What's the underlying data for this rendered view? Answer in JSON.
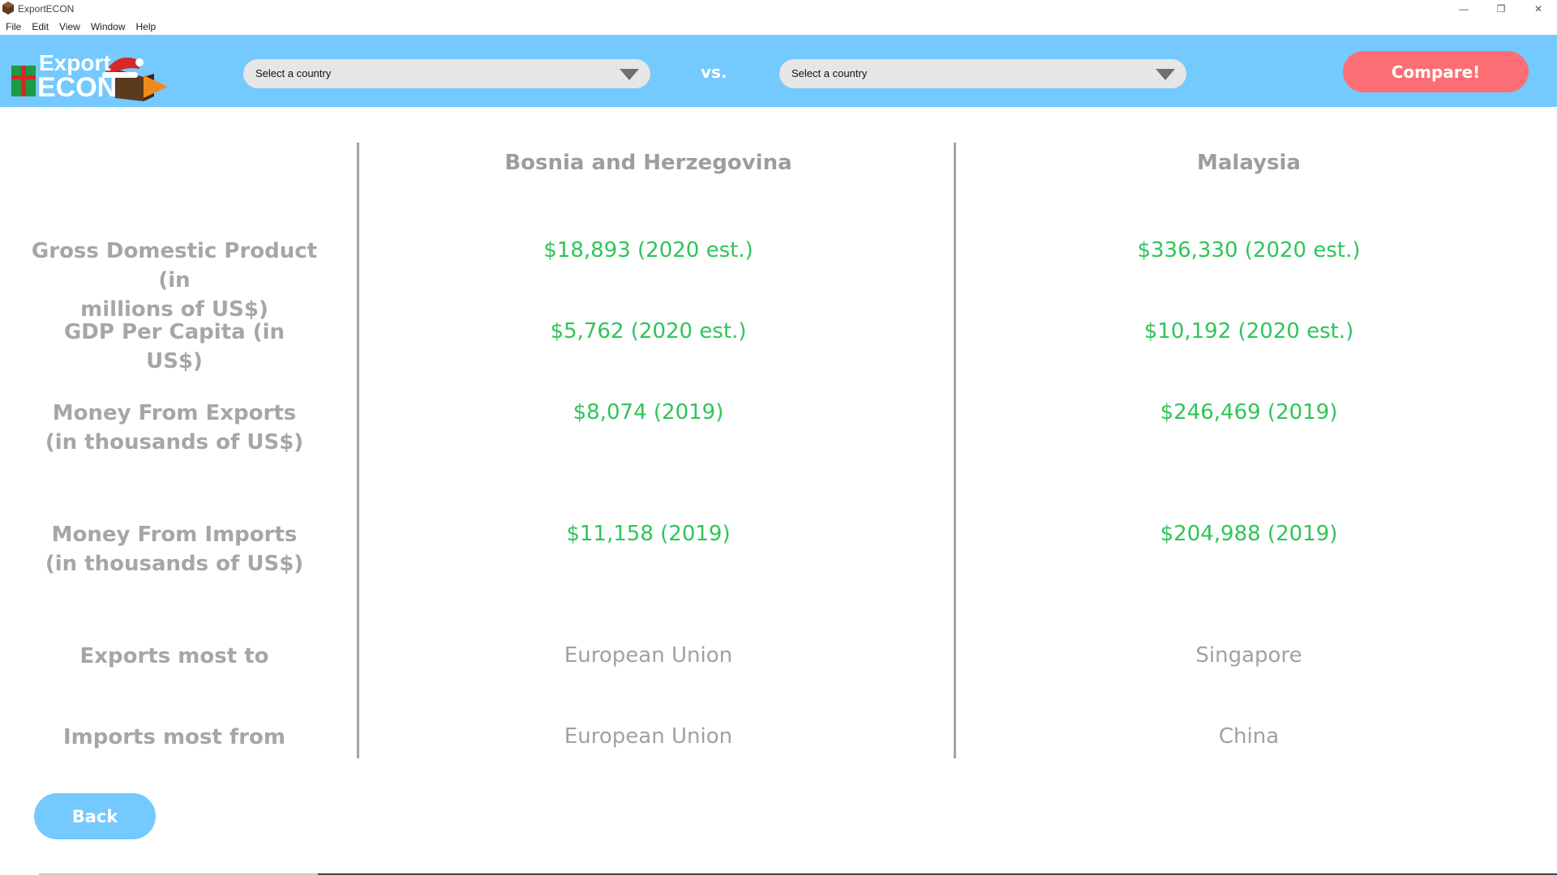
{
  "window": {
    "title": "ExportECON",
    "controls": {
      "minimize": "—",
      "restore": "❐",
      "close": "✕"
    }
  },
  "menu": {
    "items": [
      "File",
      "Edit",
      "View",
      "Window",
      "Help"
    ]
  },
  "toolbar": {
    "logo_line1": "Export",
    "logo_line2": "ECON",
    "country_select_left": "Select a country",
    "vs_label": "vs.",
    "country_select_right": "Select a country",
    "compare_label": "Compare!"
  },
  "comparison": {
    "country_left": "Bosnia and Herzegovina",
    "country_right": "Malaysia",
    "rows": [
      {
        "label_lines": [
          "Gross Domestic Product (in",
          "millions of US$)"
        ],
        "left": "$18,893 (2020 est.)",
        "right": "$336,330 (2020 est.)"
      },
      {
        "label_lines": [
          "GDP Per Capita (in",
          "US$)"
        ],
        "left": "$5,762 (2020 est.)",
        "right": "$10,192 (2020 est.)"
      },
      {
        "label_lines": [
          "Money From Exports",
          "(in thousands of US$)"
        ],
        "left": "$8,074 (2019)",
        "right": "$246,469 (2019)"
      },
      {
        "label_lines": [
          "Money From Imports",
          "(in thousands of US$)"
        ],
        "left": "$11,158 (2019)",
        "right": "$204,988 (2019)"
      },
      {
        "label_lines": [
          "Exports most to"
        ],
        "left": "European Union",
        "right": "Singapore"
      },
      {
        "label_lines": [
          "Imports most from"
        ],
        "left": "European Union",
        "right": "China"
      }
    ]
  },
  "footer": {
    "back_label": "Back"
  },
  "colors": {
    "header_bg": "#74c9fe",
    "compare_button": "#fd6e74",
    "value_green": "#2fc45a",
    "label_gray": "#a6a6a6"
  }
}
